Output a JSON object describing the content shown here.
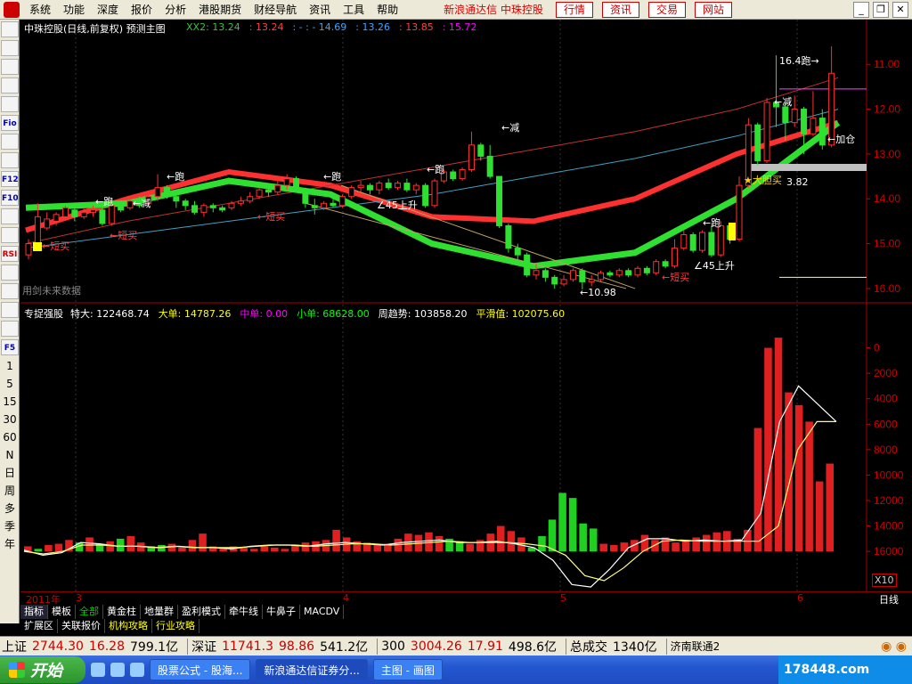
{
  "menubar": {
    "items": [
      "系统",
      "功能",
      "深度",
      "报价",
      "分析",
      "港股期货",
      "财经导航",
      "资讯",
      "工具",
      "帮助"
    ],
    "brand": "新浪通达信 中珠控股",
    "nav_buttons": [
      "行情",
      "资讯",
      "交易",
      "网站"
    ]
  },
  "left_toolbar": {
    "items": [
      "",
      "",
      "",
      "",
      "",
      "Fio",
      "",
      "",
      "F12",
      "F10",
      "",
      "",
      "RSI",
      "",
      "",
      "",
      "",
      "F5",
      "1",
      "5",
      "15",
      "30",
      "60",
      "N",
      "日",
      "周",
      "多",
      "季",
      "年"
    ]
  },
  "price_panel": {
    "title": "中珠控股(日线,前复权) 预测主图",
    "legend": [
      {
        "label": "XX2: 13.24",
        "color": "#40c040"
      },
      {
        "label": ": 13.24",
        "color": "#ff4040"
      },
      {
        "label": ": - : - 14.69",
        "color": "#40a0ff"
      },
      {
        "label": ": 13.26",
        "color": "#40a0ff"
      },
      {
        "label": ": 13.85",
        "color": "#ff4040"
      },
      {
        "label": ": 15.72",
        "color": "#ff00ff"
      }
    ],
    "y_ticks": [
      "16.00",
      "15.00",
      "14.00",
      "13.00",
      "12.00",
      "11.00"
    ],
    "annotations": {
      "run": "←跑",
      "reduce": "←减",
      "buy_short": "←短买",
      "rise45": "∠45上升",
      "low": "←10.98",
      "high": "16.4跑→",
      "add": "←加仓",
      "bold_buy": "★大胆买",
      "bold_buy_value": "3.82",
      "lock": "↑锁",
      "future": "用剑未来数据"
    }
  },
  "volume_panel": {
    "title": "专捉强股",
    "legend": [
      {
        "label": "特大: 122468.74",
        "color": "#ffffff"
      },
      {
        "label": "大单: 14787.26",
        "color": "#ffff00"
      },
      {
        "label": "中单: 0.00",
        "color": "#ff00ff"
      },
      {
        "label": "小单: 68628.00",
        "color": "#00ff00"
      },
      {
        "label": "周趋势: 103858.20",
        "color": "#ffffff"
      },
      {
        "label": "平滑值: 102075.60",
        "color": "#ffff00"
      }
    ],
    "y_ticks": [
      "16000",
      "14000",
      "12000",
      "10000",
      "8000",
      "6000",
      "4000",
      "2000",
      "0"
    ],
    "unit": "X10"
  },
  "dates": {
    "year": "2011年",
    "months": [
      "3",
      "4",
      "5",
      "6"
    ],
    "period": "日线"
  },
  "tabs_row1": [
    "指标",
    "模板",
    "全部",
    "黄金柱",
    "地量群",
    "盈利模式",
    "牵牛线",
    "牛鼻子",
    "MACDV"
  ],
  "tabs_row2": [
    "扩展区",
    "关联报价",
    "机构攻略",
    "行业攻略"
  ],
  "status_bar": {
    "sh_label": "上证",
    "sh_value": "2744.30",
    "sh_change": "16.28",
    "sh_amount": "799.1亿",
    "sz_label": "深证",
    "sz_value": "11741.3",
    "sz_change": "98.86",
    "sz_amount": "541.2亿",
    "idx300_label": "300",
    "idx300_value": "3004.26",
    "idx300_change": "17.91",
    "idx300_amount": "498.6亿",
    "total_label": "总成交",
    "total_value": "1340亿",
    "server": "济南联通2"
  },
  "taskbar": {
    "start": "开始",
    "tasks": [
      "股票公式 - 股海...",
      "新浪通达信证券分...",
      "主图 - 画图"
    ],
    "tray_text": "178448.com"
  },
  "chart_data": [
    {
      "type": "candlestick",
      "title": "中珠控股(日线,前复权) 预测主图",
      "ylim": [
        10.8,
        16.6
      ],
      "y_ticks": [
        11,
        12,
        13,
        14,
        15,
        16
      ],
      "x_month_labels": [
        "3",
        "4",
        "5",
        "6"
      ],
      "candles": [
        {
          "o": 11.75,
          "c": 12.0,
          "h": 12.1,
          "l": 11.65
        },
        {
          "o": 11.9,
          "c": 12.6,
          "h": 12.9,
          "l": 11.85
        },
        {
          "o": 12.35,
          "c": 12.55,
          "h": 12.7,
          "l": 12.3
        },
        {
          "o": 12.5,
          "c": 12.65,
          "h": 12.7,
          "l": 12.4
        },
        {
          "o": 12.6,
          "c": 12.8,
          "h": 12.85,
          "l": 12.5
        },
        {
          "o": 12.75,
          "c": 12.6,
          "h": 12.85,
          "l": 12.5
        },
        {
          "o": 12.6,
          "c": 12.7,
          "h": 12.8,
          "l": 12.55
        },
        {
          "o": 12.7,
          "c": 12.75,
          "h": 12.85,
          "l": 12.6
        },
        {
          "o": 12.75,
          "c": 12.45,
          "h": 12.9,
          "l": 12.4
        },
        {
          "o": 12.45,
          "c": 12.85,
          "h": 13.0,
          "l": 12.4
        },
        {
          "o": 12.85,
          "c": 12.75,
          "h": 12.95,
          "l": 12.7
        },
        {
          "o": 12.8,
          "c": 12.95,
          "h": 13.0,
          "l": 12.75
        },
        {
          "o": 12.95,
          "c": 12.85,
          "h": 13.05,
          "l": 12.8
        },
        {
          "o": 12.9,
          "c": 13.05,
          "h": 13.1,
          "l": 12.85
        },
        {
          "o": 13.05,
          "c": 13.25,
          "h": 13.55,
          "l": 12.95
        },
        {
          "o": 13.25,
          "c": 13.1,
          "h": 13.3,
          "l": 13.0
        },
        {
          "o": 13.05,
          "c": 12.95,
          "h": 13.1,
          "l": 12.8
        },
        {
          "o": 12.95,
          "c": 12.85,
          "h": 13.0,
          "l": 12.75
        },
        {
          "o": 12.85,
          "c": 12.7,
          "h": 12.95,
          "l": 12.65
        },
        {
          "o": 12.7,
          "c": 12.85,
          "h": 12.9,
          "l": 12.6
        },
        {
          "o": 12.85,
          "c": 12.8,
          "h": 12.9,
          "l": 12.7
        },
        {
          "o": 12.8,
          "c": 12.75,
          "h": 12.85,
          "l": 12.7
        },
        {
          "o": 12.8,
          "c": 12.9,
          "h": 12.95,
          "l": 12.75
        },
        {
          "o": 12.9,
          "c": 12.95,
          "h": 13.05,
          "l": 12.85
        },
        {
          "o": 12.95,
          "c": 13.05,
          "h": 13.15,
          "l": 12.9
        },
        {
          "o": 13.05,
          "c": 13.2,
          "h": 13.25,
          "l": 13.0
        },
        {
          "o": 13.2,
          "c": 13.15,
          "h": 13.3,
          "l": 13.05
        },
        {
          "o": 13.15,
          "c": 13.3,
          "h": 13.4,
          "l": 13.1
        },
        {
          "o": 13.3,
          "c": 13.45,
          "h": 13.55,
          "l": 13.2
        },
        {
          "o": 13.45,
          "c": 13.2,
          "h": 13.5,
          "l": 13.15
        },
        {
          "o": 13.2,
          "c": 12.9,
          "h": 13.25,
          "l": 12.8
        },
        {
          "o": 12.85,
          "c": 12.8,
          "h": 13.0,
          "l": 12.65
        },
        {
          "o": 12.8,
          "c": 12.9,
          "h": 12.95,
          "l": 12.75
        },
        {
          "o": 12.9,
          "c": 12.85,
          "h": 13.0,
          "l": 12.8
        },
        {
          "o": 12.85,
          "c": 13.05,
          "h": 13.1,
          "l": 12.8
        },
        {
          "o": 13.05,
          "c": 13.25,
          "h": 13.3,
          "l": 13.0
        },
        {
          "o": 13.25,
          "c": 13.3,
          "h": 13.4,
          "l": 13.15
        },
        {
          "o": 13.3,
          "c": 13.2,
          "h": 13.35,
          "l": 13.1
        },
        {
          "o": 13.2,
          "c": 13.35,
          "h": 13.4,
          "l": 13.1
        },
        {
          "o": 13.35,
          "c": 13.25,
          "h": 13.45,
          "l": 13.2
        },
        {
          "o": 13.25,
          "c": 13.35,
          "h": 13.4,
          "l": 13.2
        },
        {
          "o": 13.35,
          "c": 13.2,
          "h": 13.45,
          "l": 13.15
        },
        {
          "o": 13.2,
          "c": 13.3,
          "h": 13.35,
          "l": 13.1
        },
        {
          "o": 13.3,
          "c": 12.85,
          "h": 13.35,
          "l": 12.8
        },
        {
          "o": 12.85,
          "c": 13.4,
          "h": 13.45,
          "l": 12.8
        },
        {
          "o": 13.4,
          "c": 13.6,
          "h": 13.65,
          "l": 13.35
        },
        {
          "o": 13.6,
          "c": 13.45,
          "h": 13.65,
          "l": 13.4
        },
        {
          "o": 13.45,
          "c": 13.65,
          "h": 13.7,
          "l": 13.4
        },
        {
          "o": 13.65,
          "c": 14.2,
          "h": 14.5,
          "l": 13.6
        },
        {
          "o": 14.2,
          "c": 13.95,
          "h": 14.25,
          "l": 13.85
        },
        {
          "o": 13.95,
          "c": 13.5,
          "h": 14.2,
          "l": 13.45
        },
        {
          "o": 13.5,
          "c": 12.4,
          "h": 13.5,
          "l": 12.35
        },
        {
          "o": 12.4,
          "c": 11.9,
          "h": 12.45,
          "l": 11.8
        },
        {
          "o": 11.9,
          "c": 11.75,
          "h": 12.0,
          "l": 11.6
        },
        {
          "o": 11.75,
          "c": 11.3,
          "h": 11.8,
          "l": 11.25
        },
        {
          "o": 11.3,
          "c": 11.4,
          "h": 11.55,
          "l": 11.2
        },
        {
          "o": 11.4,
          "c": 11.25,
          "h": 11.45,
          "l": 11.15
        },
        {
          "o": 11.25,
          "c": 11.1,
          "h": 11.3,
          "l": 11.0
        },
        {
          "o": 11.1,
          "c": 11.2,
          "h": 11.3,
          "l": 11.05
        },
        {
          "o": 11.2,
          "c": 11.4,
          "h": 11.45,
          "l": 11.15
        },
        {
          "o": 11.4,
          "c": 11.15,
          "h": 11.45,
          "l": 10.98
        },
        {
          "o": 11.15,
          "c": 11.2,
          "h": 11.3,
          "l": 11.05
        },
        {
          "o": 11.2,
          "c": 11.35,
          "h": 11.4,
          "l": 11.15
        },
        {
          "o": 11.35,
          "c": 11.3,
          "h": 11.4,
          "l": 11.25
        },
        {
          "o": 11.3,
          "c": 11.4,
          "h": 11.45,
          "l": 11.25
        },
        {
          "o": 11.4,
          "c": 11.3,
          "h": 11.45,
          "l": 11.25
        },
        {
          "o": 11.3,
          "c": 11.45,
          "h": 11.5,
          "l": 11.25
        },
        {
          "o": 11.45,
          "c": 11.35,
          "h": 11.5,
          "l": 11.3
        },
        {
          "o": 11.35,
          "c": 11.6,
          "h": 11.65,
          "l": 11.3
        },
        {
          "o": 11.6,
          "c": 11.5,
          "h": 11.65,
          "l": 11.45
        },
        {
          "o": 11.5,
          "c": 11.9,
          "h": 12.1,
          "l": 11.45
        },
        {
          "o": 11.9,
          "c": 12.2,
          "h": 12.3,
          "l": 11.85
        },
        {
          "o": 12.2,
          "c": 11.85,
          "h": 12.25,
          "l": 11.8
        },
        {
          "o": 11.85,
          "c": 12.25,
          "h": 12.3,
          "l": 11.8
        },
        {
          "o": 12.25,
          "c": 11.75,
          "h": 12.4,
          "l": 11.7
        },
        {
          "o": 11.75,
          "c": 12.4,
          "h": 12.5,
          "l": 11.7
        },
        {
          "o": 12.4,
          "c": 12.1,
          "h": 12.45,
          "l": 12.0
        },
        {
          "o": 12.1,
          "c": 13.3,
          "h": 13.5,
          "l": 12.05
        },
        {
          "o": 13.3,
          "c": 14.65,
          "h": 14.8,
          "l": 13.25
        },
        {
          "o": 14.65,
          "c": 13.85,
          "h": 14.7,
          "l": 13.75
        },
        {
          "o": 13.85,
          "c": 15.15,
          "h": 15.25,
          "l": 13.8
        },
        {
          "o": 15.15,
          "c": 15.05,
          "h": 16.2,
          "l": 14.6
        },
        {
          "o": 15.05,
          "c": 14.7,
          "h": 15.15,
          "l": 14.3
        },
        {
          "o": 14.7,
          "c": 15.0,
          "h": 15.3,
          "l": 14.6
        },
        {
          "o": 15.0,
          "c": 14.45,
          "h": 15.05,
          "l": 14.0
        },
        {
          "o": 14.45,
          "c": 14.8,
          "h": 15.4,
          "l": 14.4
        },
        {
          "o": 14.8,
          "c": 14.2,
          "h": 15.0,
          "l": 14.1
        },
        {
          "o": 14.2,
          "c": 15.8,
          "h": 16.4,
          "l": 14.15
        }
      ],
      "trend_line": [
        12.3,
        13.0,
        13.6,
        13.3,
        12.6,
        12.5,
        13.0,
        14.0,
        14.7
      ],
      "horizontal_levels": [
        15.45,
        11.25,
        13.7
      ]
    },
    {
      "type": "bar",
      "title": "专捉强股",
      "ylim": [
        -3000,
        18000
      ],
      "y_ticks": [
        0,
        2000,
        4000,
        6000,
        8000,
        10000,
        12000,
        14000,
        16000
      ],
      "unit": "X10",
      "values": [
        400,
        200,
        500,
        600,
        900,
        700,
        1100,
        600,
        800,
        1000,
        1200,
        700,
        400,
        500,
        600,
        300,
        900,
        1400,
        400,
        300,
        400,
        300,
        200,
        400,
        300,
        200,
        500,
        700,
        800,
        900,
        1700,
        1100,
        800,
        700,
        600,
        600,
        1000,
        1400,
        1300,
        1500,
        1200,
        1000,
        800,
        600,
        900,
        1400,
        2000,
        1600,
        1100,
        300,
        1200,
        2500,
        4600,
        4200,
        2200,
        1800,
        600,
        500,
        700,
        900,
        1300,
        900,
        1100,
        700,
        900,
        1100,
        1300,
        1500,
        1600,
        1000,
        1700,
        9700,
        16000,
        16800,
        12500,
        11500,
        10200,
        5500,
        6900
      ],
      "signs": [
        1,
        -1,
        1,
        1,
        1,
        -1,
        1,
        -1,
        1,
        -1,
        1,
        1,
        -1,
        -1,
        1,
        1,
        1,
        1,
        1,
        1,
        1,
        1,
        1,
        1,
        1,
        1,
        1,
        1,
        1,
        1,
        1,
        1,
        1,
        1,
        1,
        1,
        1,
        1,
        1,
        1,
        1,
        -1,
        -1,
        1,
        1,
        1,
        1,
        1,
        1,
        -1,
        -1,
        -1,
        -1,
        -1,
        -1,
        -1,
        1,
        1,
        1,
        1,
        1,
        1,
        1,
        1,
        1,
        1,
        1,
        1,
        1,
        1,
        1,
        1,
        1,
        1,
        1,
        1,
        1,
        1,
        1
      ],
      "line_white": [
        100,
        -300,
        -100,
        700,
        600,
        400,
        400,
        300,
        400,
        300,
        300,
        200,
        400,
        500,
        500,
        400,
        600,
        700,
        600,
        500,
        700,
        800,
        900,
        700,
        700,
        800,
        600,
        300,
        -700,
        -2600,
        -2800,
        -1400,
        300,
        1000,
        1000,
        800,
        900,
        800,
        900,
        3000,
        10200,
        13000,
        11600,
        10200
      ],
      "line_yellow": [
        0,
        -200,
        0,
        500,
        500,
        400,
        400,
        300,
        400,
        300,
        300,
        300,
        400,
        500,
        500,
        400,
        500,
        600,
        600,
        500,
        600,
        700,
        800,
        700,
        700,
        700,
        600,
        400,
        -300,
        -1900,
        -2300,
        -1300,
        0,
        800,
        900,
        800,
        800,
        800,
        800,
        2000,
        8000,
        10200,
        10200
      ]
    }
  ]
}
